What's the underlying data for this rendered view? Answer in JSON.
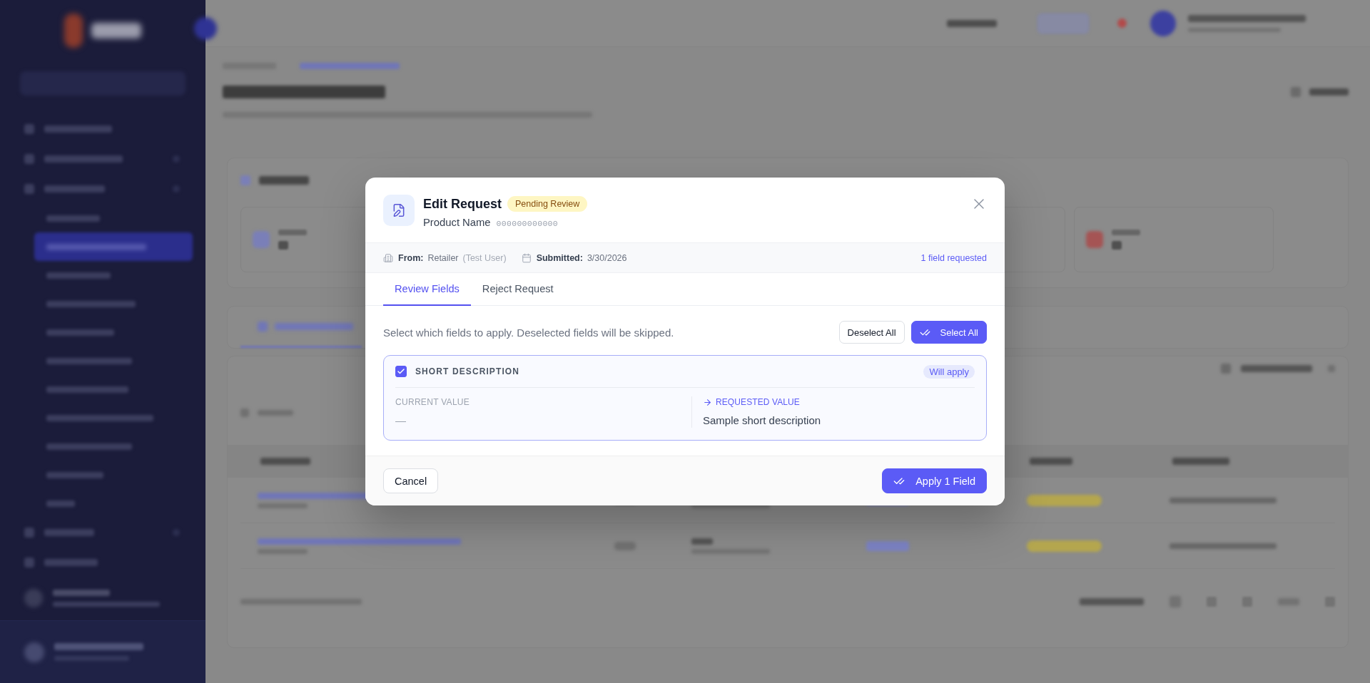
{
  "dialog": {
    "title": "Edit Request",
    "status_badge": "Pending Review",
    "product_name": "Product Name",
    "product_code": "000000000000"
  },
  "meta": {
    "from_label": "From:",
    "from_value": "Retailer",
    "from_user": "(Test User)",
    "submitted_label": "Submitted:",
    "submitted_value": "3/30/2026",
    "requested_count": "1 field requested"
  },
  "tabs": [
    {
      "label": "Review Fields",
      "selected": true
    },
    {
      "label": "Reject Request",
      "selected": false
    }
  ],
  "instructions": "Select which fields to apply. Deselected fields will be skipped.",
  "bulk_actions": [
    {
      "label": "Deselect All",
      "kind": "secondary"
    },
    {
      "label": "Select All",
      "kind": "primary"
    }
  ],
  "fields": [
    {
      "name": "SHORT DESCRIPTION",
      "checked": true,
      "status": "Will apply",
      "current_label": "CURRENT VALUE",
      "current_value": "—",
      "requested_label": "REQUESTED VALUE",
      "requested_value": "Sample short description"
    }
  ],
  "footer": {
    "cancel": "Cancel",
    "apply": "Apply 1 Field"
  }
}
